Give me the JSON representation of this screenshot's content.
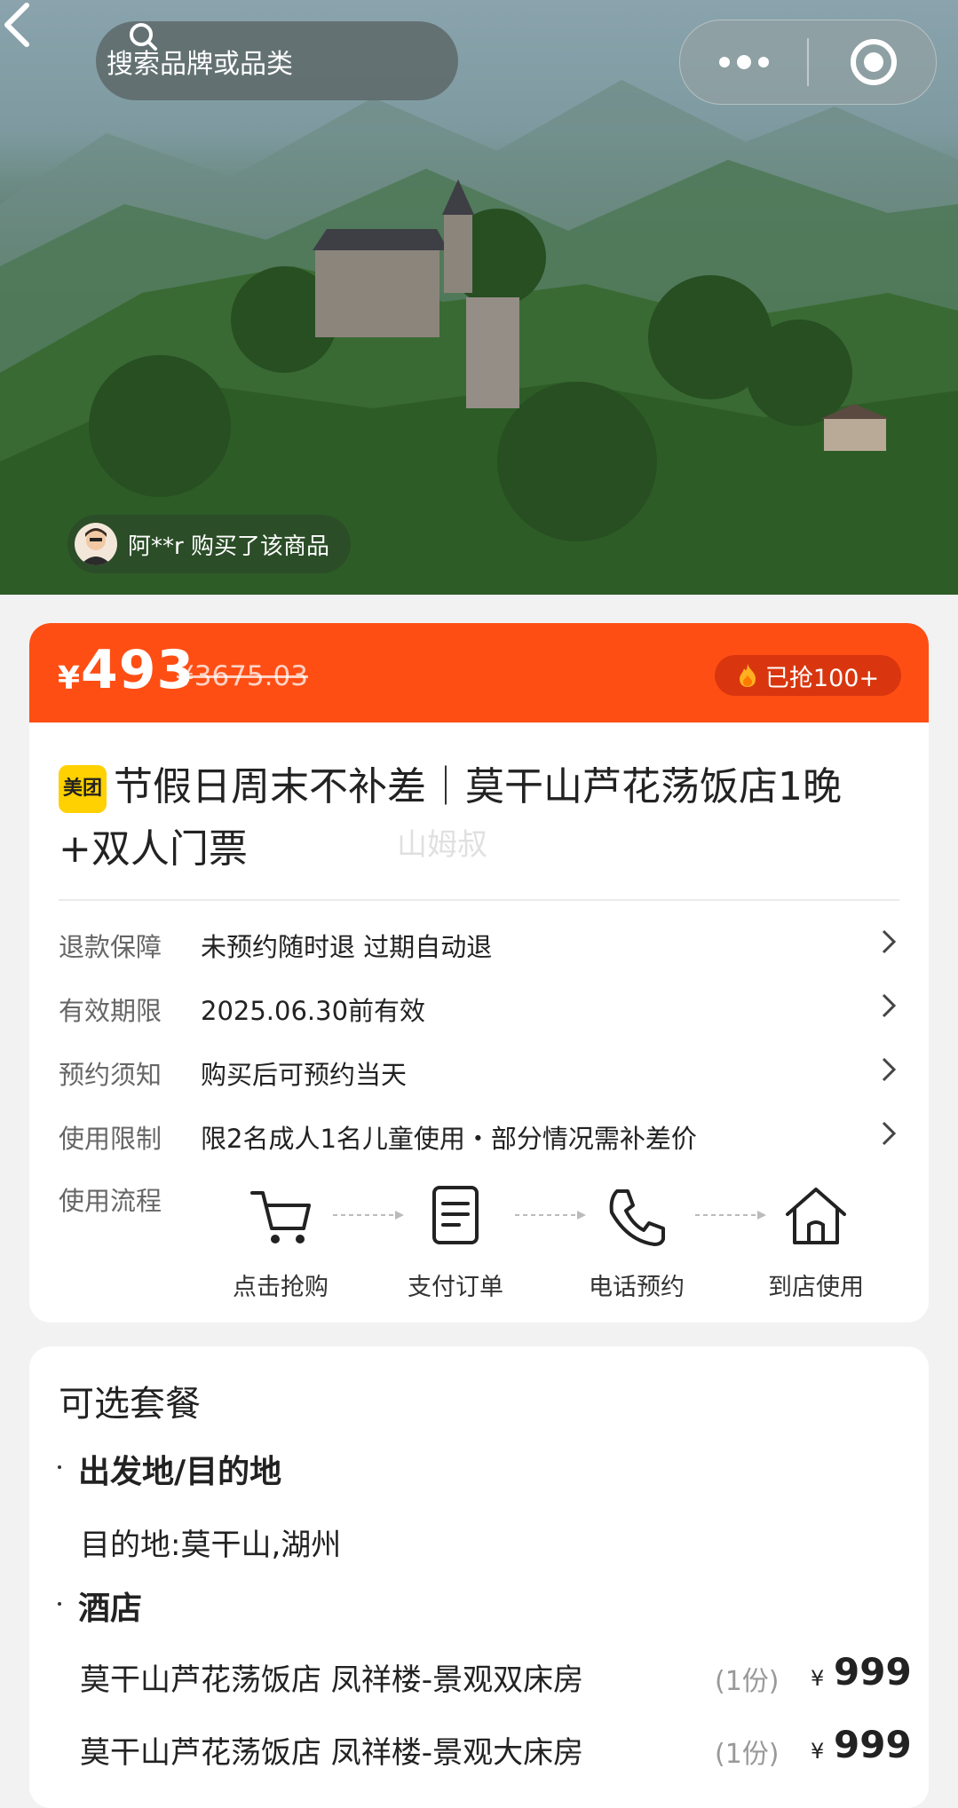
{
  "topbar": {
    "search_placeholder": "搜索品牌或品类"
  },
  "hero": {
    "buyer_notice": "阿**r 购买了该商品"
  },
  "price": {
    "currency": "¥",
    "current": "493",
    "original": "¥3675.03",
    "sold_badge": "已抢100+"
  },
  "product": {
    "brand_tag": "美团",
    "title": "节假日周末不补差｜莫干山芦花荡饭店1晚+双人门票",
    "watermark": "山姆叔"
  },
  "info_rows": [
    {
      "key": "退款保障",
      "value": "未预约随时退 过期自动退"
    },
    {
      "key": "有效期限",
      "value": "2025.06.30前有效"
    },
    {
      "key": "预约须知",
      "value": "购买后可预约当天"
    },
    {
      "key": "使用限制",
      "value": "限2名成人1名儿童使用・部分情况需补差价"
    }
  ],
  "flow": {
    "label": "使用流程",
    "steps": [
      {
        "label": "点击抢购",
        "icon": "cart-icon"
      },
      {
        "label": "支付订单",
        "icon": "document-icon"
      },
      {
        "label": "电话预约",
        "icon": "phone-icon"
      },
      {
        "label": "到店使用",
        "icon": "home-icon"
      }
    ]
  },
  "packages": {
    "title": "可选套餐",
    "section1_title": "出发地/目的地",
    "destination": "目的地:莫干山,湖州",
    "section2_title": "酒店",
    "items": [
      {
        "name": "莫干山芦花荡饭店 凤祥楼-景观双床房",
        "qty": "(1份)",
        "currency": "¥",
        "price": "999"
      },
      {
        "name": "莫干山芦花荡饭店 凤祥楼-景观大床房",
        "qty": "(1份)",
        "currency": "¥",
        "price": "999"
      }
    ]
  },
  "colors": {
    "accent": "#fe4e14",
    "brand_yellow": "#ffd100"
  }
}
